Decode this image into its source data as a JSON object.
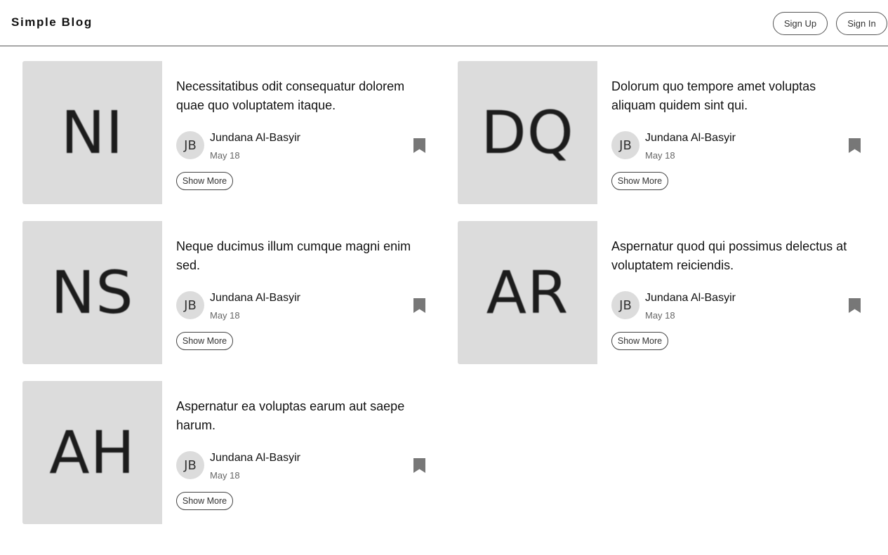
{
  "header": {
    "brand": "Simple Blog",
    "sign_up": "Sign Up",
    "sign_in": "Sign In"
  },
  "posts": [
    {
      "thumb_initials": "NI",
      "title": "Necessitatibus odit consequatur dolorem quae quo voluptatem itaque.",
      "author_initials": "JB",
      "author": "Jundana Al-Basyir",
      "date": "May 18",
      "show_more": "Show More",
      "bookmark_icon": "bookmark-icon"
    },
    {
      "thumb_initials": "DQ",
      "title": "Dolorum quo tempore amet voluptas aliquam quidem sint qui.",
      "author_initials": "JB",
      "author": "Jundana Al-Basyir",
      "date": "May 18",
      "show_more": "Show More",
      "bookmark_icon": "bookmark-icon"
    },
    {
      "thumb_initials": "NS",
      "title": "Neque ducimus illum cumque magni enim sed.",
      "author_initials": "JB",
      "author": "Jundana Al-Basyir",
      "date": "May 18",
      "show_more": "Show More",
      "bookmark_icon": "bookmark-icon"
    },
    {
      "thumb_initials": "AR",
      "title": "Aspernatur quod qui possimus delectus at voluptatem reiciendis.",
      "author_initials": "JB",
      "author": "Jundana Al-Basyir",
      "date": "May 18",
      "show_more": "Show More",
      "bookmark_icon": "bookmark-icon"
    },
    {
      "thumb_initials": "AH",
      "title": "Aspernatur ea voluptas earum aut saepe harum.",
      "author_initials": "JB",
      "author": "Jundana Al-Basyir",
      "date": "May 18",
      "show_more": "Show More",
      "bookmark_icon": "bookmark-icon"
    }
  ],
  "colors": {
    "thumb_bg": "#dcdcdc",
    "bookmark": "#777777",
    "border": "#555555"
  }
}
